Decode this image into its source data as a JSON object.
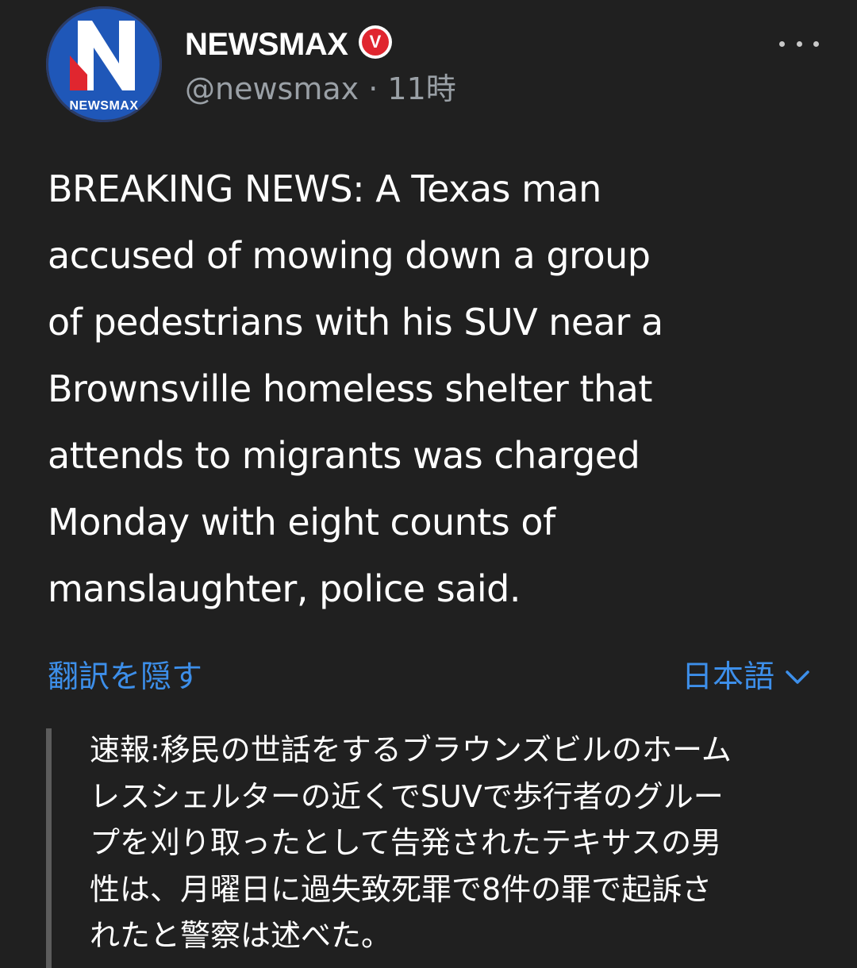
{
  "author": {
    "avatar_wordmark": "NEWSMAX",
    "avatar_letter": "N",
    "display_name": "NEWSMAX",
    "verified_badge": "V",
    "handle": "@newsmax",
    "separator": "·",
    "time_ago": "11時"
  },
  "menu": {
    "more_icon": "more-horizontal-icon"
  },
  "tweet": {
    "lines": [
      "BREAKING NEWS: A Texas man",
      "accused of mowing down a group",
      "of pedestrians with his SUV near a",
      "Brownsville homeless shelter that",
      "attends to migrants was charged",
      "Monday with eight counts of",
      "manslaughter, police said."
    ]
  },
  "translation": {
    "hide_label": "翻訳を隠す",
    "language_label": "日本語",
    "lines": [
      "速報:移民の世話をするブラウンズビルのホーム",
      "レスシェルターの近くでSUVで歩行者のグルー",
      "プを刈り取ったとして告発されたテキサスの男",
      "性は、月曜日に過失致死罪で8件の罪で起訴さ",
      "れたと警察は述べた。"
    ]
  },
  "colors": {
    "background": "#202020",
    "link": "#3d8fea",
    "muted": "#9aa0a6",
    "avatar_blue": "#1f57b8",
    "badge_red": "#e0262f"
  }
}
